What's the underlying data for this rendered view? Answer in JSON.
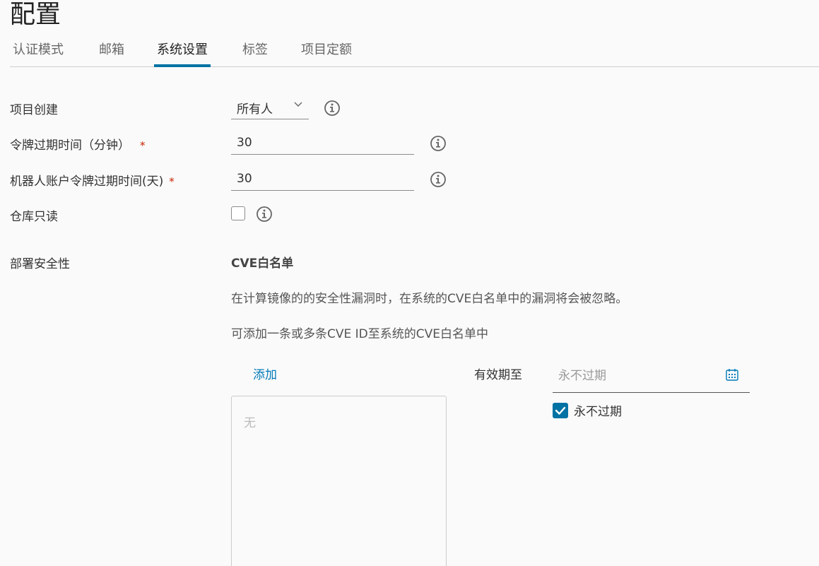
{
  "page": {
    "title": "配置"
  },
  "tabs": [
    {
      "label": "认证模式"
    },
    {
      "label": "邮箱"
    },
    {
      "label": "系统设置"
    },
    {
      "label": "标签"
    },
    {
      "label": "项目定额"
    }
  ],
  "active_tab": "系统设置",
  "settings": {
    "project_creation": {
      "label": "项目创建",
      "value": "所有人"
    },
    "token_expiry": {
      "label": "令牌过期时间（分钟）",
      "required": "*",
      "value": "30"
    },
    "robot_token_expiry": {
      "label": "机器人账户令牌过期时间(天)",
      "required": "*",
      "value": "30"
    },
    "read_only": {
      "label": "仓库只读",
      "checked": false
    }
  },
  "security": {
    "label": "部署安全性",
    "cve_title": "CVE白名单",
    "desc1": "在计算镜像的的安全性漏洞时，在系统的CVE白名单中的漏洞将会被忽略。",
    "desc2": "可添加一条或多条CVE ID至系统的CVE白名单中",
    "add_label": "添加",
    "empty_text": "无",
    "expire_label": "有效期至",
    "expire_placeholder": "永不过期",
    "never_expire_label": "永不过期",
    "never_expire_checked": true
  },
  "icons": {
    "info": "info-icon",
    "chevron": "chevron-down-icon",
    "calendar": "calendar-icon",
    "check": "check-icon"
  },
  "colors": {
    "accent": "#0072a3",
    "link": "#0079b8",
    "required": "#c92100"
  }
}
